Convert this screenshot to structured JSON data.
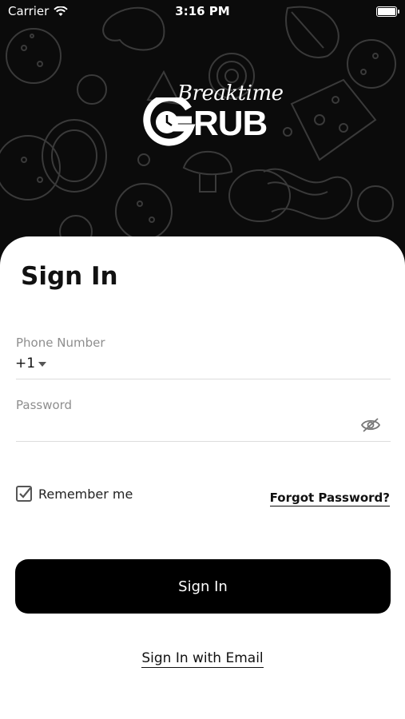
{
  "status_bar": {
    "carrier": "Carrier",
    "time": "3:16 PM",
    "wifi_icon": "wifi-icon",
    "battery_icon": "battery-icon"
  },
  "brand": {
    "script_text": "Breaktime",
    "word_text": "RUB",
    "logo_letter": "G",
    "clock_icon": "clock-icon"
  },
  "form": {
    "title": "Sign In",
    "phone_label": "Phone Number",
    "country_code": "+1",
    "password_label": "Password",
    "eye_icon": "eye-off-icon",
    "remember_label": "Remember me",
    "remember_checked": true,
    "forgot_label": "Forgot Password?",
    "submit_label": "Sign In",
    "email_link": "Sign In with Email"
  },
  "colors": {
    "primary": "#000000",
    "background_dark": "#0b0b0b",
    "muted_text": "#8e8e8e",
    "divider": "#dcdcdc"
  }
}
